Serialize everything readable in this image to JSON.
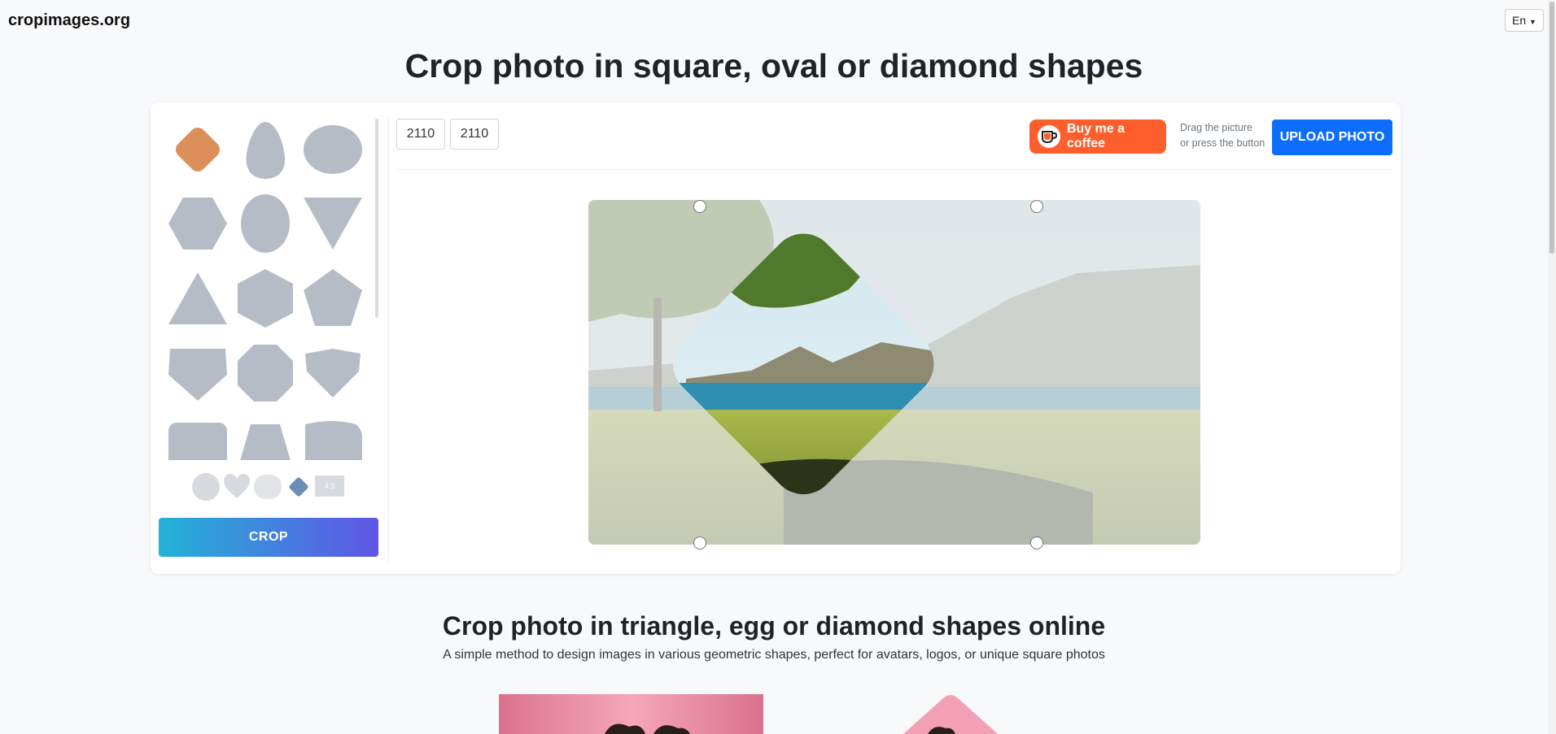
{
  "header": {
    "brand": "cropimages.org",
    "language": "En"
  },
  "title": "Crop photo in square, oval or diamond shapes",
  "shapes": [
    "rounded-diamond-shape",
    "egg-shape",
    "oval-shape",
    "hexagon-shape",
    "ellipse-vertical-shape",
    "inverted-triangle-shape",
    "triangle-shape",
    "hexagon-rounded-shape",
    "pentagon-shape",
    "pentagon-alt-shape",
    "octagon-shape",
    "gem-shape",
    "rounded-rect-shape",
    "trapezoid-shape",
    "wavy-rect-shape"
  ],
  "extra_options": {
    "ratio_label": "4:3"
  },
  "crop_button": "CROP",
  "toolbar": {
    "width": "2110",
    "height": "2110",
    "coffee_label": "Buy me a coffee",
    "hint_line1": "Drag the picture",
    "hint_line2": "or press the button",
    "upload_label": "UPLOAD PHOTO"
  },
  "section": {
    "title": "Crop photo in triangle, egg or diamond shapes online",
    "subtitle": "A simple method to design images in various geometric shapes, perfect for avatars, logos, or unique square photos"
  },
  "colors": {
    "selected_shape": "#dd8f5a",
    "shape_fill": "#b5bcc5",
    "coffee": "#fe5e2c",
    "upload": "#0d6efd"
  }
}
